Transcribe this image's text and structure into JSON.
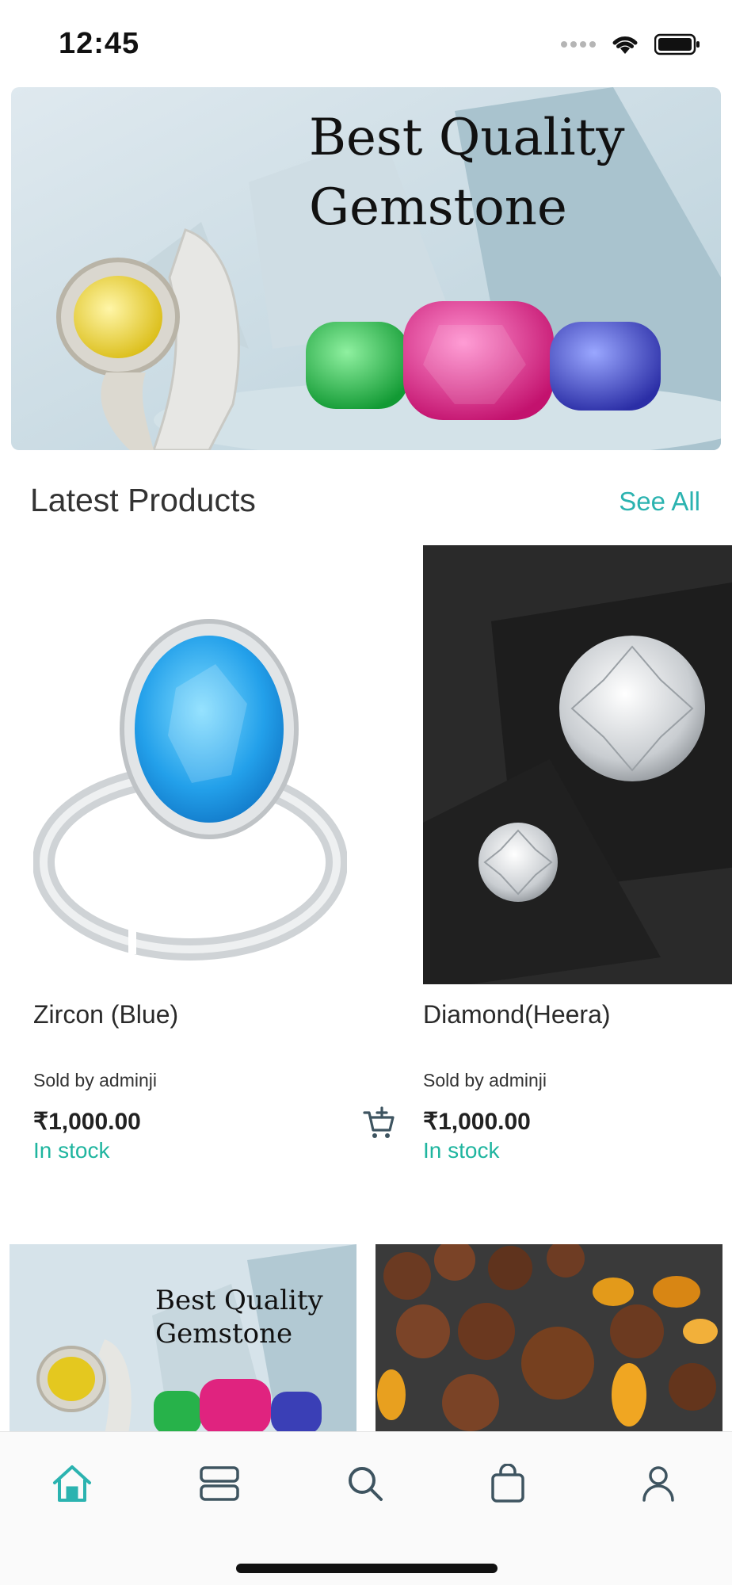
{
  "status_bar": {
    "time": "12:45"
  },
  "banner": {
    "title_line1": "Best Quality",
    "title_line2": "Gemstone"
  },
  "section": {
    "title": "Latest Products",
    "see_all": "See All"
  },
  "products": [
    {
      "name": "Zircon (Blue)",
      "seller": "Sold by adminji",
      "price": "₹1,000.00",
      "stock": "In stock"
    },
    {
      "name": "Diamond(Heera)",
      "seller": "Sold by adminji",
      "price": "₹1,000.00",
      "stock": "In stock"
    }
  ],
  "tiles": [
    {
      "title_line1": "Best Quality",
      "title_line2": "Gemstone"
    }
  ],
  "nav": {
    "items": [
      "home-icon",
      "catalog-icon",
      "search-icon",
      "bag-icon",
      "profile-icon"
    ],
    "active": "home-icon"
  },
  "colors": {
    "accent": "#2bb3b0",
    "stock": "#1fb59f",
    "nav_icon": "#3e5460"
  }
}
